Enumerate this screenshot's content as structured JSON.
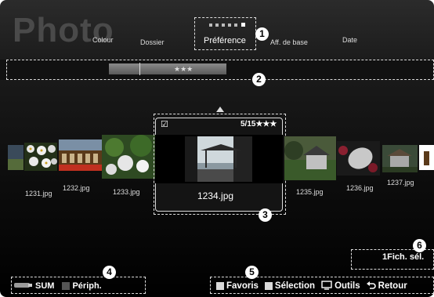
{
  "app": {
    "title": "Photo"
  },
  "tabs": [
    {
      "label": "Colour",
      "active": false
    },
    {
      "label": "Dossier",
      "active": false
    },
    {
      "label": "Préférence",
      "active": true
    },
    {
      "label": "Aff. de base",
      "active": false
    },
    {
      "label": "Date",
      "active": false
    }
  ],
  "callouts": {
    "n1": "1",
    "n2": "2",
    "n3": "3",
    "n4": "4",
    "n5": "5",
    "n6": "6"
  },
  "rating_bar": {
    "stars": "★★★"
  },
  "thumbnails": [
    {
      "name": "1231.jpg"
    },
    {
      "name": "1232.jpg"
    },
    {
      "name": "1233.jpg"
    },
    {
      "name": "1235.jpg"
    },
    {
      "name": "1236.jpg"
    },
    {
      "name": "1237.jpg"
    }
  ],
  "selected": {
    "name": "1234.jpg",
    "rating": "5/15★★★",
    "checked": true
  },
  "status": {
    "selected_count": "1Fich. sél."
  },
  "device_bar": {
    "sum_label": "SUM",
    "periph_label": "Périph."
  },
  "guide": {
    "favoris": "Favoris",
    "selection": "Sélection",
    "outils": "Outils",
    "retour": "Retour"
  },
  "colors": {
    "red_key": "#d9d9d9",
    "green_key": "#d9d9d9",
    "accent": "#ffffff"
  }
}
